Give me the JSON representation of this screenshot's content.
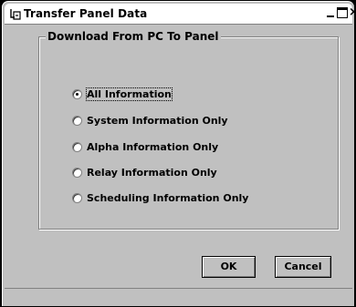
{
  "window": {
    "title": "Transfer Panel Data",
    "icon": "transfer-app-icon",
    "caption_buttons": {
      "minimize": "minimize-icon",
      "maximize": "maximize-icon",
      "close": "×"
    }
  },
  "group": {
    "legend": "Download From PC To Panel",
    "options": [
      {
        "label": "All Information",
        "checked": true
      },
      {
        "label": "System Information Only",
        "checked": false
      },
      {
        "label": "Alpha Information Only",
        "checked": false
      },
      {
        "label": "Relay Information Only",
        "checked": false
      },
      {
        "label": "Scheduling Information Only",
        "checked": false
      }
    ]
  },
  "buttons": {
    "ok": "OK",
    "cancel": "Cancel"
  },
  "colors": {
    "face": "#c0c0c0",
    "shadow": "#808080",
    "highlight": "#ffffff",
    "title_bg": "#ffffff"
  }
}
